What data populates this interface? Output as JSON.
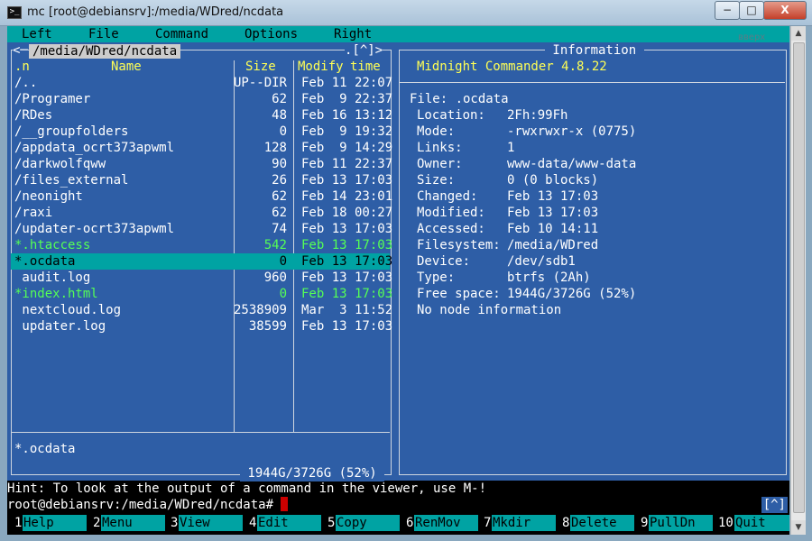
{
  "window": {
    "title": "mc [root@debiansrv]:/media/WDred/ncdata",
    "min_icon": "−",
    "max_icon": "□",
    "close_icon": "X"
  },
  "menubar": {
    "items": [
      "Left",
      "File",
      "Command",
      "Options",
      "Right"
    ],
    "hint": "вверх"
  },
  "left_panel": {
    "path": " /media/WDred/ncdata ",
    "corner_left": "<─",
    "corner_right": ".[^]>",
    "header": {
      "sort": ".n",
      "name": "Name",
      "size": "Size",
      "modify": "Modify",
      "time": "time"
    },
    "files": [
      {
        "name": "/..",
        "size": "UP--DIR",
        "modified": "Feb 11 22:07"
      },
      {
        "name": "/Programer",
        "size": "62",
        "modified": "Feb  9 22:37"
      },
      {
        "name": "/RDes",
        "size": "48",
        "modified": "Feb 16 13:12"
      },
      {
        "name": "/__groupfolders",
        "size": "0",
        "modified": "Feb  9 19:32"
      },
      {
        "name": "/appdata_ocrt373apwml",
        "size": "128",
        "modified": "Feb  9 14:29"
      },
      {
        "name": "/darkwolfqww",
        "size": "90",
        "modified": "Feb 11 22:37"
      },
      {
        "name": "/files_external",
        "size": "26",
        "modified": "Feb 13 17:03"
      },
      {
        "name": "/neonight",
        "size": "62",
        "modified": "Feb 14 23:01"
      },
      {
        "name": "/raxi",
        "size": "62",
        "modified": "Feb 18 00:27"
      },
      {
        "name": "/updater-ocrt373apwml",
        "size": "74",
        "modified": "Feb 13 17:03"
      },
      {
        "name": "*.htaccess",
        "size": "542",
        "modified": "Feb 13 17:03"
      },
      {
        "name": "*.ocdata",
        "size": "0",
        "modified": "Feb 13 17:03"
      },
      {
        "name": " audit.log",
        "size": "960",
        "modified": "Feb 13 17:03"
      },
      {
        "name": "*index.html",
        "size": "0",
        "modified": "Feb 13 17:03"
      },
      {
        "name": " nextcloud.log",
        "size": "2538909",
        "modified": "Mar  3 11:52"
      },
      {
        "name": " updater.log",
        "size": "38599",
        "modified": "Feb 13 17:03"
      }
    ],
    "mini_status": "*.ocdata",
    "free_space": " 1944G/3726G (52%) "
  },
  "right_panel": {
    "title": " Information ",
    "app": "Midnight Commander 4.8.22",
    "file_line": "File: .ocdata",
    "fields": [
      {
        "key": "Location:",
        "value": "2Fh:99Fh"
      },
      {
        "key": "Mode:",
        "value": "-rwxrwxr-x (0775)"
      },
      {
        "key": "Links:",
        "value": "1"
      },
      {
        "key": "Owner:",
        "value": "www-data/www-data"
      },
      {
        "key": "Size:",
        "value": "0 (0 blocks)"
      },
      {
        "key": "Changed:",
        "value": "Feb 13 17:03"
      },
      {
        "key": "Modified:",
        "value": "Feb 13 17:03"
      },
      {
        "key": "Accessed:",
        "value": "Feb 10 14:11"
      },
      {
        "key": "Filesystem:",
        "value": "/media/WDred"
      },
      {
        "key": "Device:",
        "value": "/dev/sdb1"
      },
      {
        "key": "Type:",
        "value": "btrfs (2Ah)"
      },
      {
        "key": "Free space:",
        "value": "1944G/3726G (52%)"
      }
    ],
    "no_node": "No node information"
  },
  "hint": "Hint: To look at the output of a command in the viewer, use M-!",
  "prompt": "root@debiansrv:/media/WDred/ncdata#",
  "caret_button": "[^]",
  "fkeys": [
    {
      "num": "1",
      "label": "Help"
    },
    {
      "num": "2",
      "label": "Menu"
    },
    {
      "num": "3",
      "label": "View"
    },
    {
      "num": "4",
      "label": "Edit"
    },
    {
      "num": "5",
      "label": "Copy"
    },
    {
      "num": "6",
      "label": "RenMov"
    },
    {
      "num": "7",
      "label": "Mkdir"
    },
    {
      "num": "8",
      "label": "Delete"
    },
    {
      "num": "9",
      "label": "PullDn"
    },
    {
      "num": "10",
      "label": "Quit"
    }
  ],
  "colors": {
    "panel_bg": "#2e5ea6",
    "accent": "#00a3a3",
    "header_yellow": "#ffff55",
    "exec_green": "#55ff55"
  }
}
